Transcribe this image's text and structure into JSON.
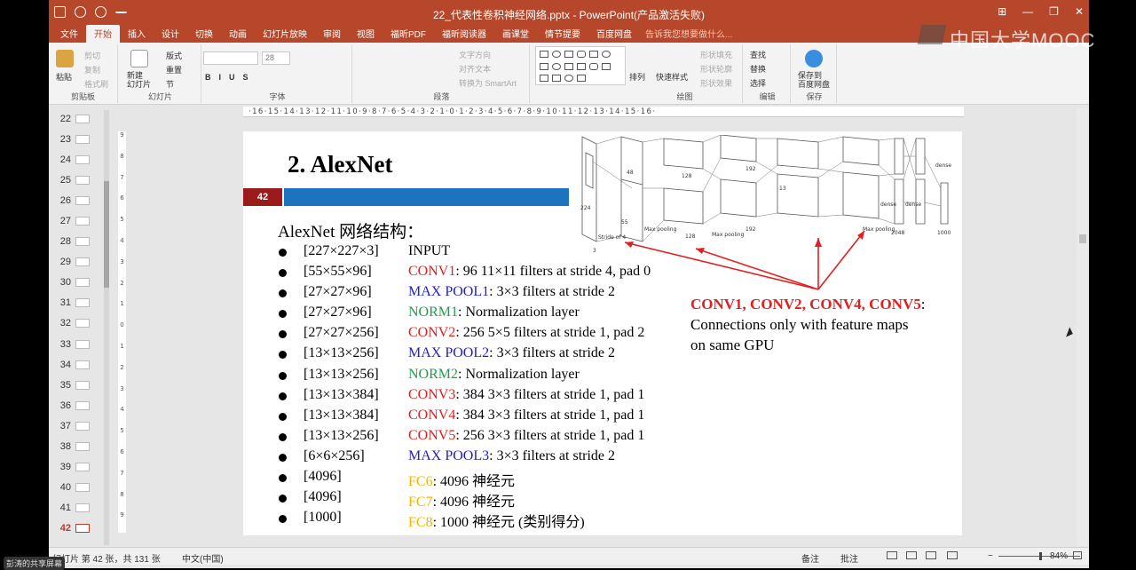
{
  "window": {
    "title": "22_代表性卷积神经网络.pptx - PowerPoint(产品激活失败)",
    "controls": [
      "⊞",
      "—",
      "❐",
      "✕"
    ]
  },
  "ribbon": {
    "tabs": [
      "文件",
      "开始",
      "插入",
      "设计",
      "切换",
      "动画",
      "幻灯片放映",
      "审阅",
      "视图",
      "福昕PDF",
      "福昕阅读器",
      "画课堂",
      "情节提要",
      "百度网盘"
    ],
    "active_tab": "开始",
    "tellme": "告诉我您想要做什么...",
    "groups": {
      "clipboard": {
        "label": "剪贴板",
        "paste": "粘贴",
        "cut": "剪切",
        "copy": "复制",
        "format_painter": "格式刷"
      },
      "slides": {
        "label": "幻灯片",
        "new_slide": "新建\n幻灯片",
        "layout": "版式",
        "reset": "重置",
        "section": "节"
      },
      "font": {
        "label": "字体",
        "font_size": "28"
      },
      "paragraph": {
        "label": "段落",
        "text_direction": "文字方向",
        "align_text": "对齐文本",
        "smartart": "转换为 SmartArt"
      },
      "drawing": {
        "label": "绘图",
        "arrange": "排列",
        "quick_styles": "快速样式",
        "shape_fill": "形状填充",
        "shape_outline": "形状轮廓",
        "shape_effects": "形状效果"
      },
      "editing": {
        "label": "编辑",
        "find": "查找",
        "replace": "替换",
        "select": "选择"
      },
      "save": {
        "label": "保存",
        "save_to": "保存到\n百度网盘"
      }
    }
  },
  "ruler": {
    "horizontal": "·16·15·14·13·12·11·10·9·8·7·6·5·4·3·2·1·0·1·2·3·4·5·6·7·8·9·10·11·12·13·14·15·16·",
    "vertical": [
      "9",
      "8",
      "7",
      "6",
      "5",
      "4",
      "3",
      "2",
      "1",
      "0",
      "1",
      "2",
      "3",
      "4",
      "5",
      "6",
      "7",
      "8",
      "9"
    ]
  },
  "thumbnails": {
    "numbers": [
      "22",
      "23",
      "24",
      "25",
      "26",
      "27",
      "28",
      "29",
      "30",
      "31",
      "32",
      "33",
      "34",
      "35",
      "36",
      "37",
      "38",
      "39",
      "40",
      "41",
      "42"
    ],
    "selected": "42"
  },
  "slide": {
    "title": "2.   AlexNet",
    "number": "42",
    "subtitle": "AlexNet 网络结构：",
    "layers": [
      {
        "dims": "[227×227×3]",
        "name": "INPUT",
        "desc": "",
        "color": "#000000"
      },
      {
        "dims": "[55×55×96]",
        "name": "CONV1",
        "desc": ": 96 11×11 filters at stride 4, pad 0",
        "color": "#e02020"
      },
      {
        "dims": "[27×27×96]",
        "name": "MAX POOL1",
        "desc": ": 3×3 filters at stride 2",
        "color": "#1f1fcc"
      },
      {
        "dims": "[27×27×96]",
        "name": "NORM1",
        "desc": ": Normalization layer",
        "color": "#1aa04a"
      },
      {
        "dims": "[27×27×256]",
        "name": "CONV2",
        "desc": ": 256 5×5 filters at stride 1, pad 2",
        "color": "#e02020"
      },
      {
        "dims": "[13×13×256]",
        "name": "MAX POOL2",
        "desc": ": 3×3 filters at stride 2",
        "color": "#1f1fcc"
      },
      {
        "dims": "[13×13×256]",
        "name": "NORM2",
        "desc": ": Normalization layer",
        "color": "#1aa04a"
      },
      {
        "dims": "[13×13×384]",
        "name": "CONV3",
        "desc": ": 384 3×3 filters at stride 1, pad 1",
        "color": "#e02020"
      },
      {
        "dims": "[13×13×384]",
        "name": "CONV4",
        "desc": ": 384 3×3 filters at stride 1, pad 1",
        "color": "#e02020"
      },
      {
        "dims": "[13×13×256]",
        "name": "CONV5",
        "desc": ": 256 3×3 filters at stride 1, pad 1",
        "color": "#e02020"
      },
      {
        "dims": "[6×6×256]",
        "name": "MAX POOL3",
        "desc": ": 3×3 filters at stride 2",
        "color": "#1f1fcc"
      },
      {
        "dims": "[4096]",
        "name": "FC6",
        "desc": ": 4096 神经元",
        "color": "#f0b400"
      },
      {
        "dims": "[4096]",
        "name": "FC7",
        "desc": ": 4096 神经元",
        "color": "#f0b400"
      },
      {
        "dims": "[1000]",
        "name": "FC8",
        "desc": ": 1000 神经元 (类别得分)",
        "color": "#f0b400"
      }
    ],
    "note": {
      "highlight": "CONV1, CONV2, CONV4, CONV5",
      "colon": ":",
      "line1": "Connections only with feature maps",
      "line2": "on same GPU"
    },
    "diagram_labels": {
      "pool_a": "Max\npooling",
      "pool_b": "Max\npooling",
      "pool_c": "Max\npooling",
      "stride": "Stride\nof 4",
      "dense_a": "dense",
      "dense_b": "dense",
      "dense_c": "dense",
      "n48": "48",
      "n128a": "128",
      "n128b": "128",
      "n192a": "192",
      "n192b": "192",
      "n224": "224",
      "n55": "55",
      "n13": "13",
      "n3": "3",
      "n2048": "2048",
      "n1000": "1000"
    }
  },
  "statusbar": {
    "slide_info": "幻灯片 第 42 张，共 131 张",
    "language": "中文(中国)",
    "notes": "备注",
    "comments": "批注",
    "zoom": "84%"
  },
  "overlay": {
    "watermark": "中国大学MOOC",
    "share_label": "彭涛的共享屏幕"
  }
}
